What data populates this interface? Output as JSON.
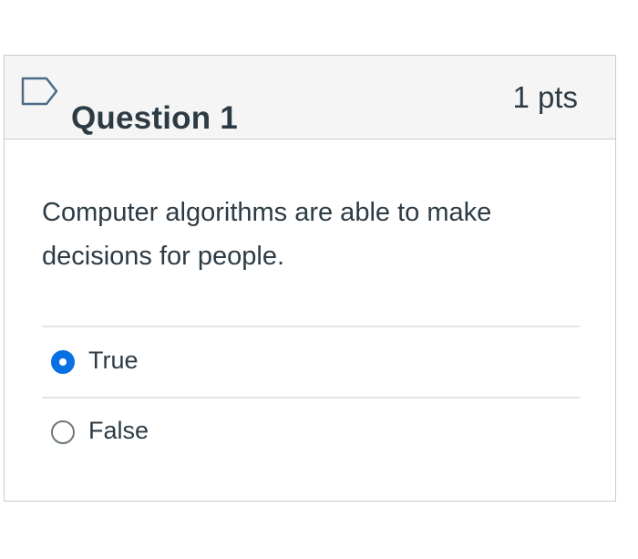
{
  "question": {
    "title": "Question 1",
    "points": "1 pts",
    "text": "Computer algorithms are able to make decisions for people.",
    "flag_icon": "flag-outline-icon"
  },
  "answers": [
    {
      "label": "True",
      "selected": true
    },
    {
      "label": "False",
      "selected": false
    }
  ],
  "colors": {
    "header_background": "#f5f5f5",
    "border": "#c7cdd1",
    "text": "#2d3b45",
    "selected_radio": "#0770e3",
    "unselected_radio_border": "#6b7780"
  }
}
